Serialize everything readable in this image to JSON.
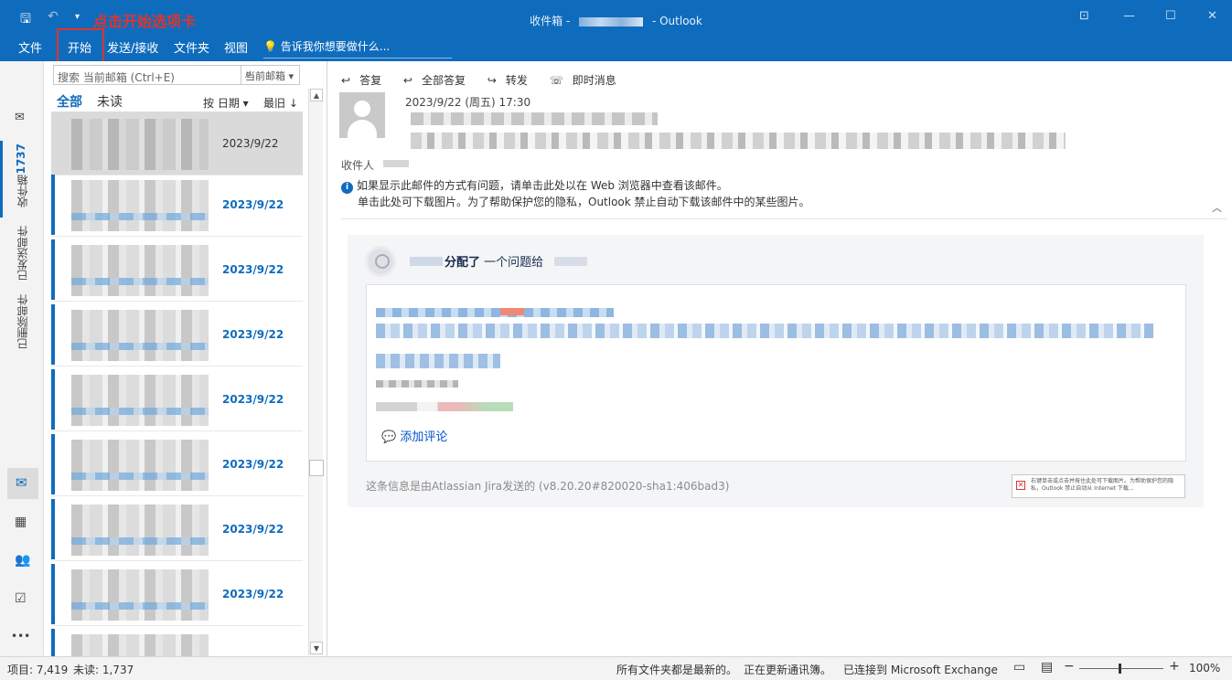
{
  "titlebar": {
    "title_prefix": "收件箱 -",
    "title_suffix": "- Outlook",
    "annotation": "点击开始选项卡",
    "qa_save": "🖫",
    "qa_undo": "↶",
    "qa_more": "▾",
    "win_ribbon": "⊡",
    "win_min": "—",
    "win_max": "☐",
    "win_close": "✕"
  },
  "ribbon": {
    "tabs": [
      "文件",
      "开始",
      "发送/接收",
      "文件夹",
      "视图"
    ],
    "tellme": "告诉我你想要做什么..."
  },
  "rail": {
    "inbox": "收件箱",
    "inbox_count": "1737",
    "sent": "已发送邮件",
    "deleted": "已删除邮件",
    "more": "•••"
  },
  "list": {
    "search_placeholder": "搜索 当前邮箱 (Ctrl+E)",
    "scope": "当前邮箱",
    "filter_all": "全部",
    "filter_unread": "未读",
    "sort_by": "按 日期 ▾",
    "sort_order": "最旧 ↓",
    "items": [
      {
        "date": "2023/9/22"
      },
      {
        "date": "2023/9/22"
      },
      {
        "date": "2023/9/22"
      },
      {
        "date": "2023/9/22"
      },
      {
        "date": "2023/9/22"
      },
      {
        "date": "2023/9/22"
      },
      {
        "date": "2023/9/22"
      },
      {
        "date": "2023/9/22"
      }
    ]
  },
  "reading": {
    "reply": "答复",
    "reply_all": "全部答复",
    "forward": "转发",
    "im": "即时消息",
    "datetime": "2023/9/22 (周五) 17:30",
    "to_label": "收件人",
    "info1": "如果显示此邮件的方式有问题，请单击此处以在 Web 浏览器中查看该邮件。",
    "info2": "单击此处可下载图片。为了帮助保护您的隐私，Outlook 禁止自动下载该邮件中的某些图片。",
    "card": {
      "assigned_bold": "分配了",
      "assigned_rest": " 一个问题给",
      "add_comment": "添加评论",
      "footer": "这条信息是由Atlassian Jira发送的 (v8.20.20#820020-sha1:406bad3)",
      "img_placeholder": "右键单击或点击并按住此处可下载图片。为帮助保护您的隐私，Outlook 禁止自动从 Internet 下载..."
    }
  },
  "status": {
    "items": "项目: 7,419",
    "unread": "未读: 1,737",
    "folders": "所有文件夹都是最新的。",
    "updating": "正在更新通讯簿。",
    "connected": "已连接到 Microsoft Exchange",
    "zoom": "100%"
  }
}
